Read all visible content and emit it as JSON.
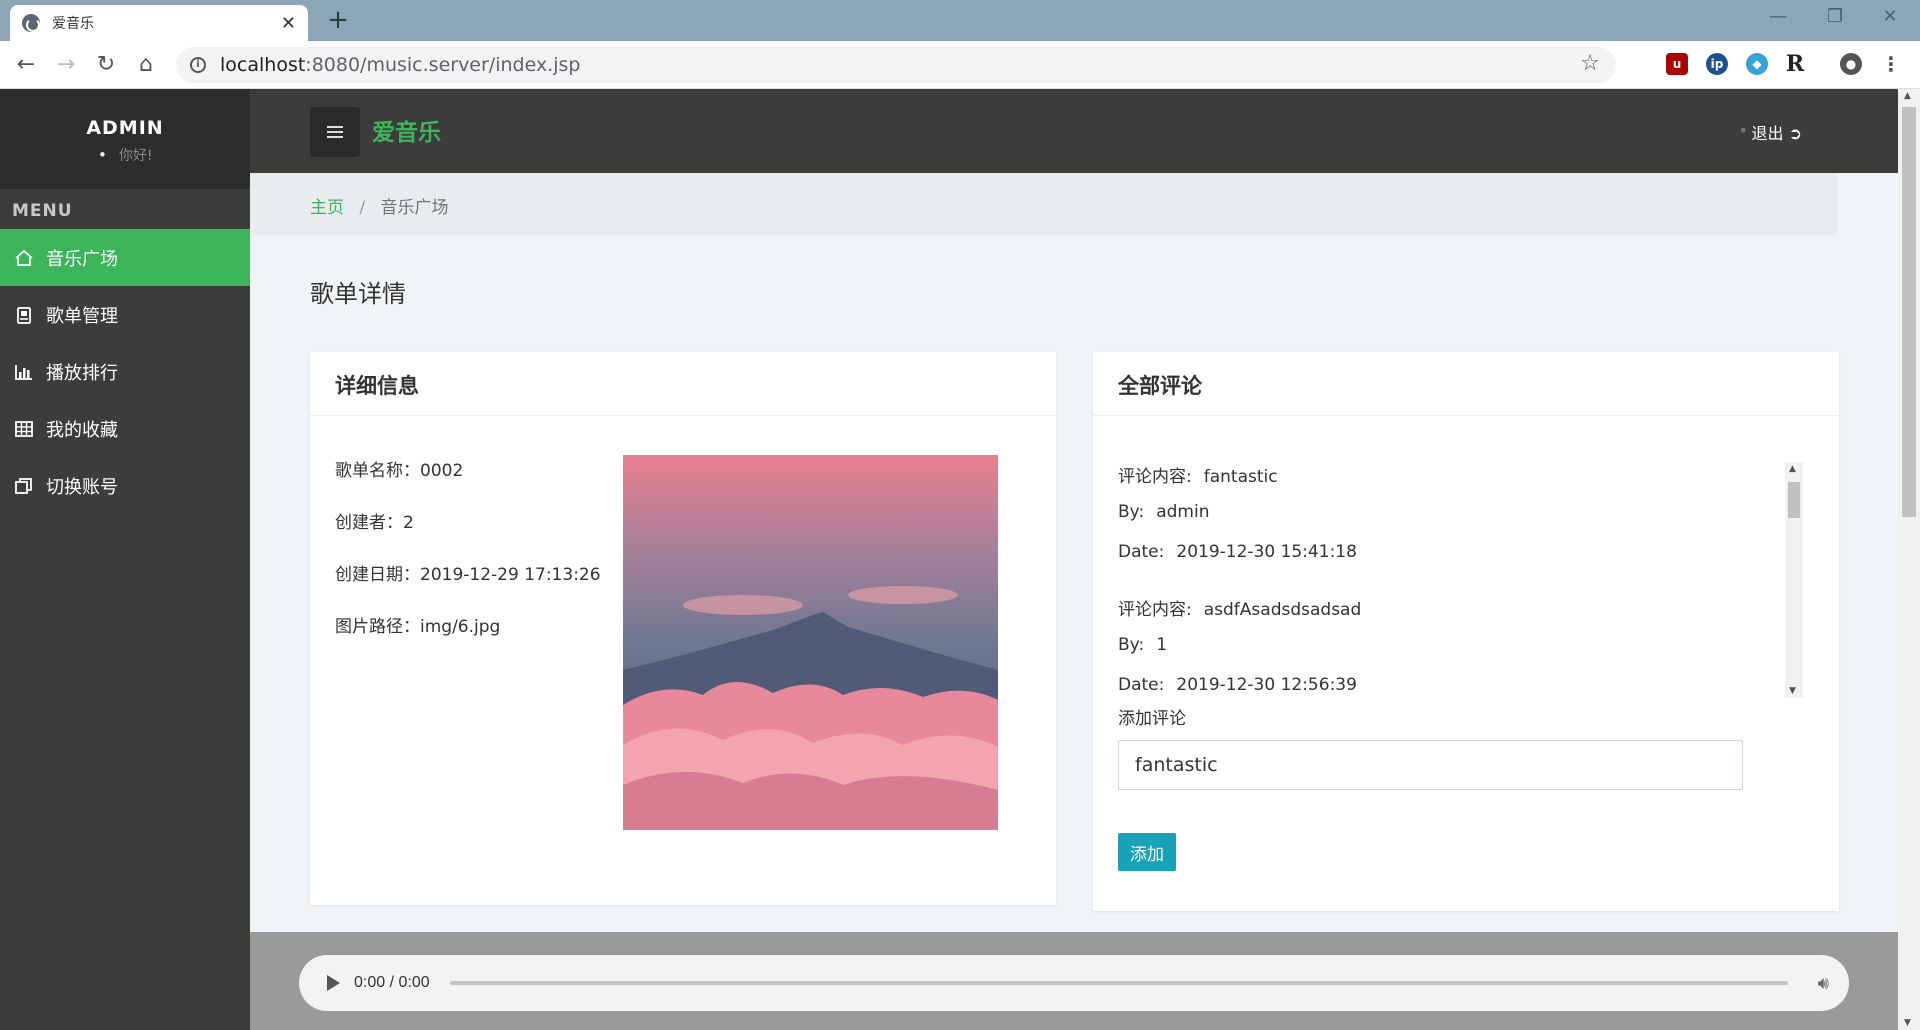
{
  "browser": {
    "tab_title": "爱音乐",
    "url_host": "localhost",
    "url_rest": ":8080/music.server/index.jsp"
  },
  "sidebar": {
    "user": "ADMIN",
    "greeting": "你好!",
    "menu_title": "MENU",
    "items": [
      {
        "label": "音乐广场",
        "icon": "home-icon",
        "active": true
      },
      {
        "label": "歌单管理",
        "icon": "clipboard-icon",
        "active": false
      },
      {
        "label": "播放排行",
        "icon": "bar-chart-icon",
        "active": false
      },
      {
        "label": "我的收藏",
        "icon": "grid-icon",
        "active": false
      },
      {
        "label": "切换账号",
        "icon": "switch-icon",
        "active": false
      }
    ]
  },
  "header": {
    "brand": "爱音乐",
    "logout": "退出"
  },
  "breadcrumb": {
    "home": "主页",
    "separator": "/",
    "current": "音乐广场"
  },
  "page_title": "歌单详情",
  "detail": {
    "title": "详细信息",
    "name_label": "歌单名称：",
    "name": "0002",
    "creator_label": "创建者：",
    "creator": "2",
    "date_label": "创建日期：",
    "date": "2019-12-29 17:13:26",
    "path_label": "图片路径：",
    "path": "img/6.jpg"
  },
  "comments": {
    "title": "全部评论",
    "content_label": "评论内容:",
    "by_label": "By:",
    "date_label": "Date:",
    "list": [
      {
        "content": "fantastic",
        "by": "admin",
        "date": "2019-12-30 15:41:18"
      },
      {
        "content": "asdfAsadsdsadsad",
        "by": "1",
        "date": "2019-12-30 12:56:39"
      }
    ],
    "add_label": "添加评论",
    "input_value": "fantastic",
    "add_button": "添加"
  },
  "player": {
    "time": "0:00 / 0:00"
  },
  "colors": {
    "accent": "#3cb55a",
    "sidebar_bg": "#3c3c3b",
    "button": "#17a2b8"
  }
}
